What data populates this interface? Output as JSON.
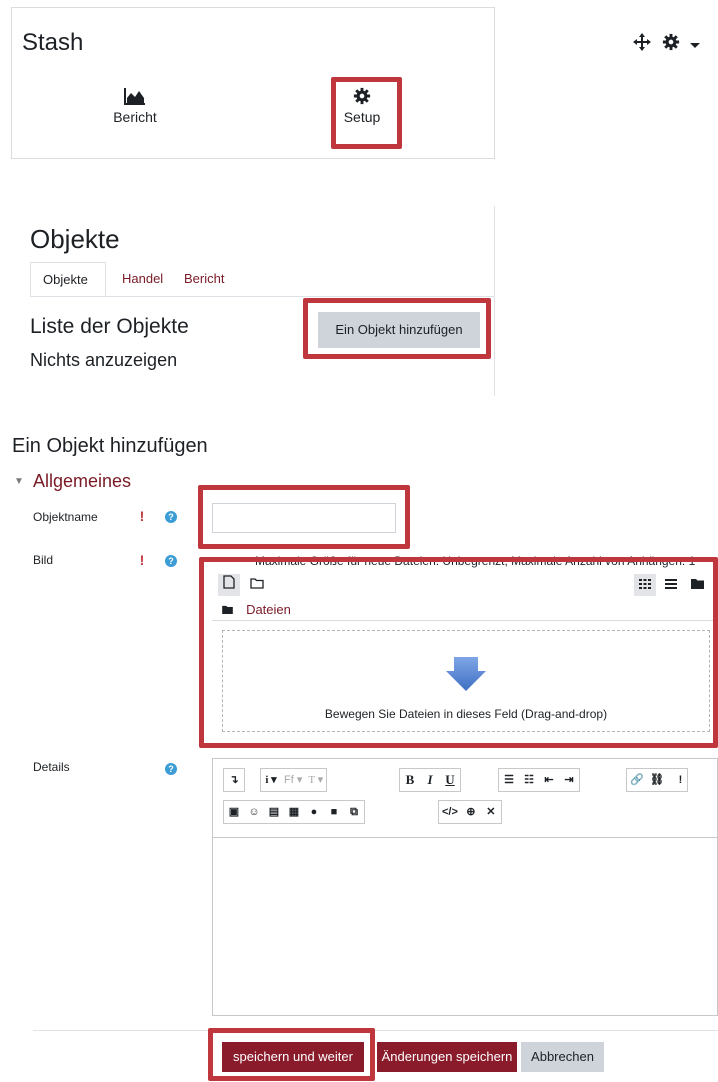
{
  "stash": {
    "title": "Stash",
    "icons": [
      "move-icon",
      "gear-icon",
      "caret-down-icon"
    ],
    "report_label": "Bericht",
    "setup_label": "Setup"
  },
  "objects_block": {
    "title": "Objekte",
    "tabs": [
      {
        "label": "Objekte",
        "active": true
      },
      {
        "label": "Handel",
        "active": false
      },
      {
        "label": "Bericht",
        "active": false
      }
    ],
    "list_title": "Liste der Objekte",
    "empty_text": "Nichts anzuzeigen",
    "add_button": "Ein Objekt hinzufügen"
  },
  "form": {
    "title": "Ein Objekt hinzufügen",
    "section": "Allgemeines",
    "name_label": "Objektname",
    "name_value": "",
    "image_label": "Bild",
    "max_info": "Maximale Größe für neue Dateien: Unbegrenzt, Maximale Anzahl von Anhängen: 1",
    "files_path": "Dateien",
    "drop_text": "Bewegen Sie Dateien in dieses Feld (Drag-and-drop)",
    "details_label": "Details",
    "details_value": ""
  },
  "buttons": {
    "save_continue": "speichern und weiter",
    "save": "Änderungen speichern",
    "cancel": "Abbrechen"
  },
  "colors": {
    "highlight": "#c0363d",
    "primary": "#8a1b2b",
    "link": "#7a1a26",
    "help": "#3c9cd6"
  }
}
